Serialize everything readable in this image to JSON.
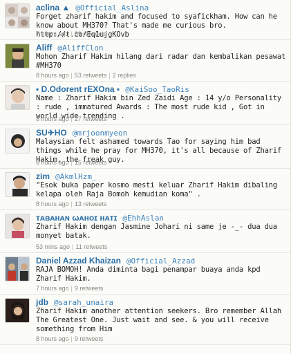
{
  "tweets": [
    {
      "name": "aclina ▲",
      "handle": "@Official_Aslina",
      "text": "Forget zharif hakim and focused to syafickham. How can he know about MH370? That's made me curious bro. http://t.co/Eq1ujgKOvb",
      "time": "7 hours ago",
      "retweets": "89 retweets",
      "replies": ""
    },
    {
      "name": "Aliff",
      "handle": "@AliffClon",
      "text": "Mohon Zharif Hakim hilang dari radar dan kembalikan pesawat #MH370",
      "time": "8 hours ago",
      "retweets": "53 retweets",
      "replies": "2 replies"
    },
    {
      "name": "▪ D.Odorent rEXOna ▪",
      "handle": "@KaiSoo_TaoRis",
      "text": "Name : Zharif Hakim bin Zed Zaidi Age : 14 y/o Personality : rude , immatured Awards : The most rude kid , Got in world wide trending .",
      "time": "8 hours ago",
      "retweets": "27 retweets",
      "replies": ""
    },
    {
      "name": "SU✈HO",
      "handle": "@mrjoonmyeon",
      "text": "Malaysian felt ashamed towards Tao for saying him bad things while he pray for MH370, it's all because of Zharif Hakim, the freak guy.",
      "time": "6 hours ago",
      "retweets": "15 retweets",
      "replies": ""
    },
    {
      "name": "zim",
      "handle": "@AkmlHzm_",
      "text": "\"Esok buka paper kosmo mesti keluar Zharif Hakim dibaling kelapa oleh Raja Bomoh kemudian koma\" .",
      "time": "8 hours ago",
      "retweets": "13 retweets",
      "replies": ""
    },
    {
      "name": "ᴛᴀʙᴀʜᴀɴ ωᴀнoɪ нᴀтɪ",
      "handle": "@EhhAslan",
      "text": "Zharif Hakim dengan Jasmine Johari ni same je -_- dua dua monyet batak.",
      "time": "53 mins ago",
      "retweets": "11 retweets",
      "replies": ""
    },
    {
      "name": "Daniel Azzad Khaizan",
      "handle": "@Official_Azzad",
      "text": "RAJA BOMOH! Anda diminta bagi penampar buaya anda kpd Zharif Hakim.",
      "time": "7 hours ago",
      "retweets": "9 retweets",
      "replies": ""
    },
    {
      "name": "jdb",
      "handle": "@sarah_umaira",
      "text": "Zharif Hakim another attention seekers. Bro remember Allah The Greatest One. Just wait and see. & you will receive something from Him",
      "time": "8 hours ago",
      "retweets": "9 retweets",
      "replies": ""
    }
  ]
}
